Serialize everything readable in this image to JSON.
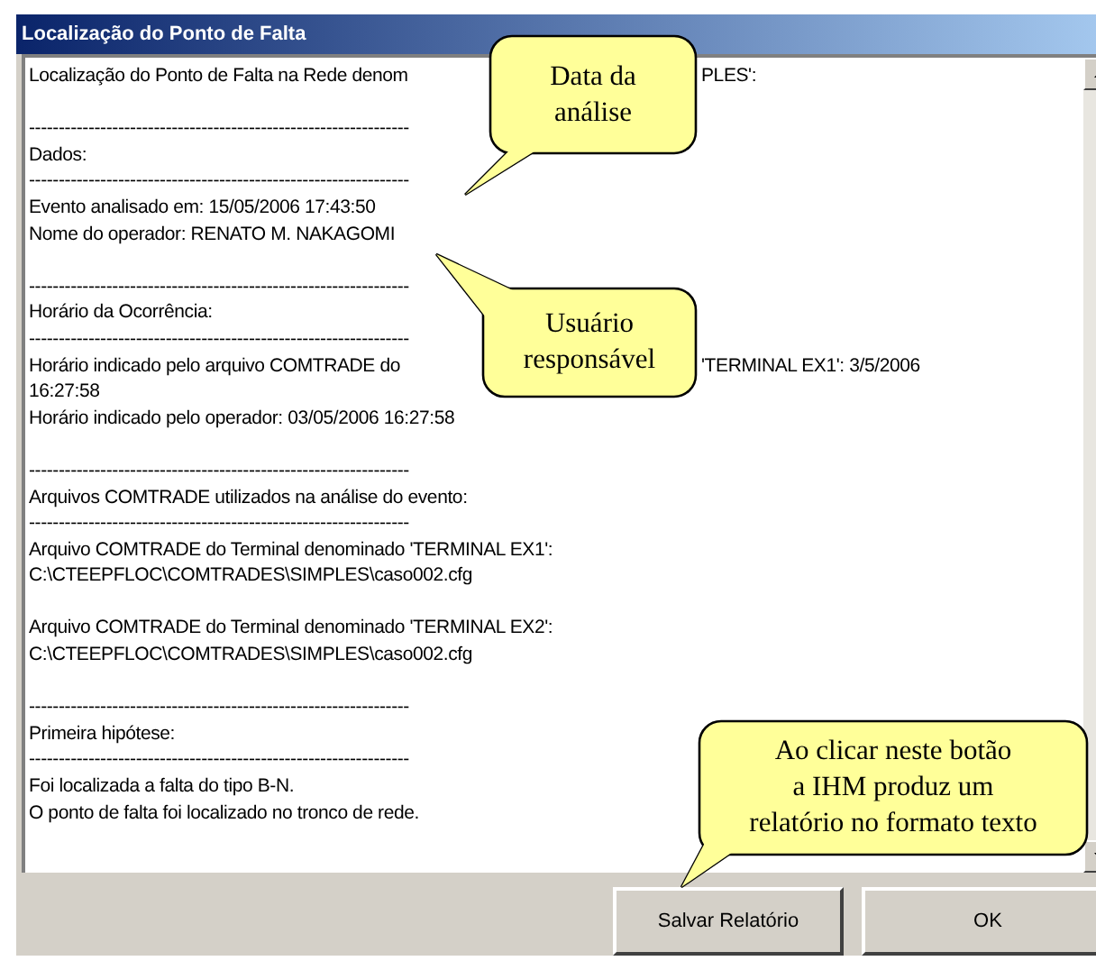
{
  "window": {
    "title": "Localização do Ponto de Falta"
  },
  "report": [
    {
      "kind": "text",
      "text": "Localização do Ponto de Falta na Rede denom",
      "tail": "PLES':"
    },
    {
      "kind": "blank"
    },
    {
      "kind": "text",
      "text": "----------------------------------------------------------------"
    },
    {
      "kind": "text",
      "text": "Dados:"
    },
    {
      "kind": "text",
      "text": "----------------------------------------------------------------"
    },
    {
      "kind": "text",
      "text": "Evento analisado em: 15/05/2006 17:43:50"
    },
    {
      "kind": "text",
      "text": "Nome do operador: RENATO M. NAKAGOMI"
    },
    {
      "kind": "blank"
    },
    {
      "kind": "text",
      "text": "----------------------------------------------------------------"
    },
    {
      "kind": "text",
      "text": "Horário da Ocorrência:"
    },
    {
      "kind": "text",
      "text": "----------------------------------------------------------------"
    },
    {
      "kind": "text",
      "text": "Horário indicado pelo arquivo COMTRADE do",
      "tail": "'TERMINAL EX1': 3/5/2006"
    },
    {
      "kind": "text",
      "text": "16:27:58"
    },
    {
      "kind": "text",
      "text": "Horário indicado pelo operador: 03/05/2006 16:27:58"
    },
    {
      "kind": "blank"
    },
    {
      "kind": "text",
      "text": "----------------------------------------------------------------"
    },
    {
      "kind": "text",
      "text": "Arquivos COMTRADE utilizados na análise do evento:"
    },
    {
      "kind": "text",
      "text": "----------------------------------------------------------------"
    },
    {
      "kind": "text",
      "text": "Arquivo COMTRADE do Terminal denominado 'TERMINAL EX1':"
    },
    {
      "kind": "text",
      "text": "C:\\CTEEPFLOC\\COMTRADES\\SIMPLES\\caso002.cfg"
    },
    {
      "kind": "blank"
    },
    {
      "kind": "text",
      "text": "Arquivo COMTRADE do Terminal denominado 'TERMINAL EX2':"
    },
    {
      "kind": "text",
      "text": "C:\\CTEEPFLOC\\COMTRADES\\SIMPLES\\caso002.cfg"
    },
    {
      "kind": "blank"
    },
    {
      "kind": "text",
      "text": "----------------------------------------------------------------"
    },
    {
      "kind": "text",
      "text": "Primeira hipótese:"
    },
    {
      "kind": "text",
      "text": "----------------------------------------------------------------"
    },
    {
      "kind": "text",
      "text": "Foi localizada a falta do tipo B-N."
    },
    {
      "kind": "text",
      "text": "O ponto de falta foi localizado no tronco de rede."
    }
  ],
  "buttons": [
    "Salvar Relatório",
    "OK"
  ],
  "callouts": [
    {
      "text": "Data da\nanálise"
    },
    {
      "text": "Usuário\nresponsável"
    },
    {
      "text": "Ao clicar neste botão\na IHM produz um\nrelatório no formato texto"
    }
  ]
}
